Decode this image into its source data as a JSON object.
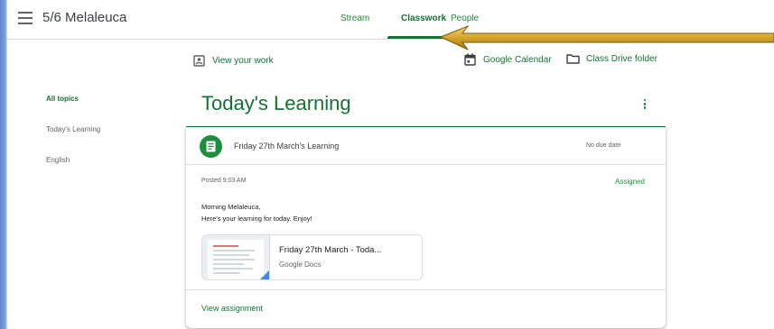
{
  "header": {
    "class_name": "5/6 Melaleuca",
    "tabs": [
      {
        "label": "Stream"
      },
      {
        "label": "Classwork",
        "active": true
      },
      {
        "label": "People"
      }
    ]
  },
  "actions": {
    "view_work": "View your work",
    "google_calendar": "Google Calendar",
    "class_drive": "Class Drive folder"
  },
  "sidebar": {
    "topics": [
      {
        "label": "All topics",
        "selected": true
      },
      {
        "label": "Today's Learning"
      },
      {
        "label": "English"
      }
    ]
  },
  "section": {
    "title": "Today's Learning",
    "assignment": {
      "title": "Friday 27th March's Learning",
      "due": "No due date",
      "posted": "Posted 9:03 AM",
      "status": "Assigned",
      "description_line1": "Morning Melaleuca,",
      "description_line2": "Here's your learning for today. Enjoy!",
      "attachment": {
        "title": "Friday 27th March - Toda...",
        "type": "Google Docs"
      },
      "view_link": "View assignment"
    }
  },
  "colors": {
    "accent": "#137333",
    "accent_light": "#1e8e3e",
    "arrow": "#d4a62a"
  },
  "icons": {
    "menu": "hamburger-menu-icon",
    "view_work": "id-badge-icon",
    "calendar": "calendar-icon",
    "folder": "folder-icon",
    "assignment": "assignment-icon",
    "more": "more-vert-icon"
  }
}
